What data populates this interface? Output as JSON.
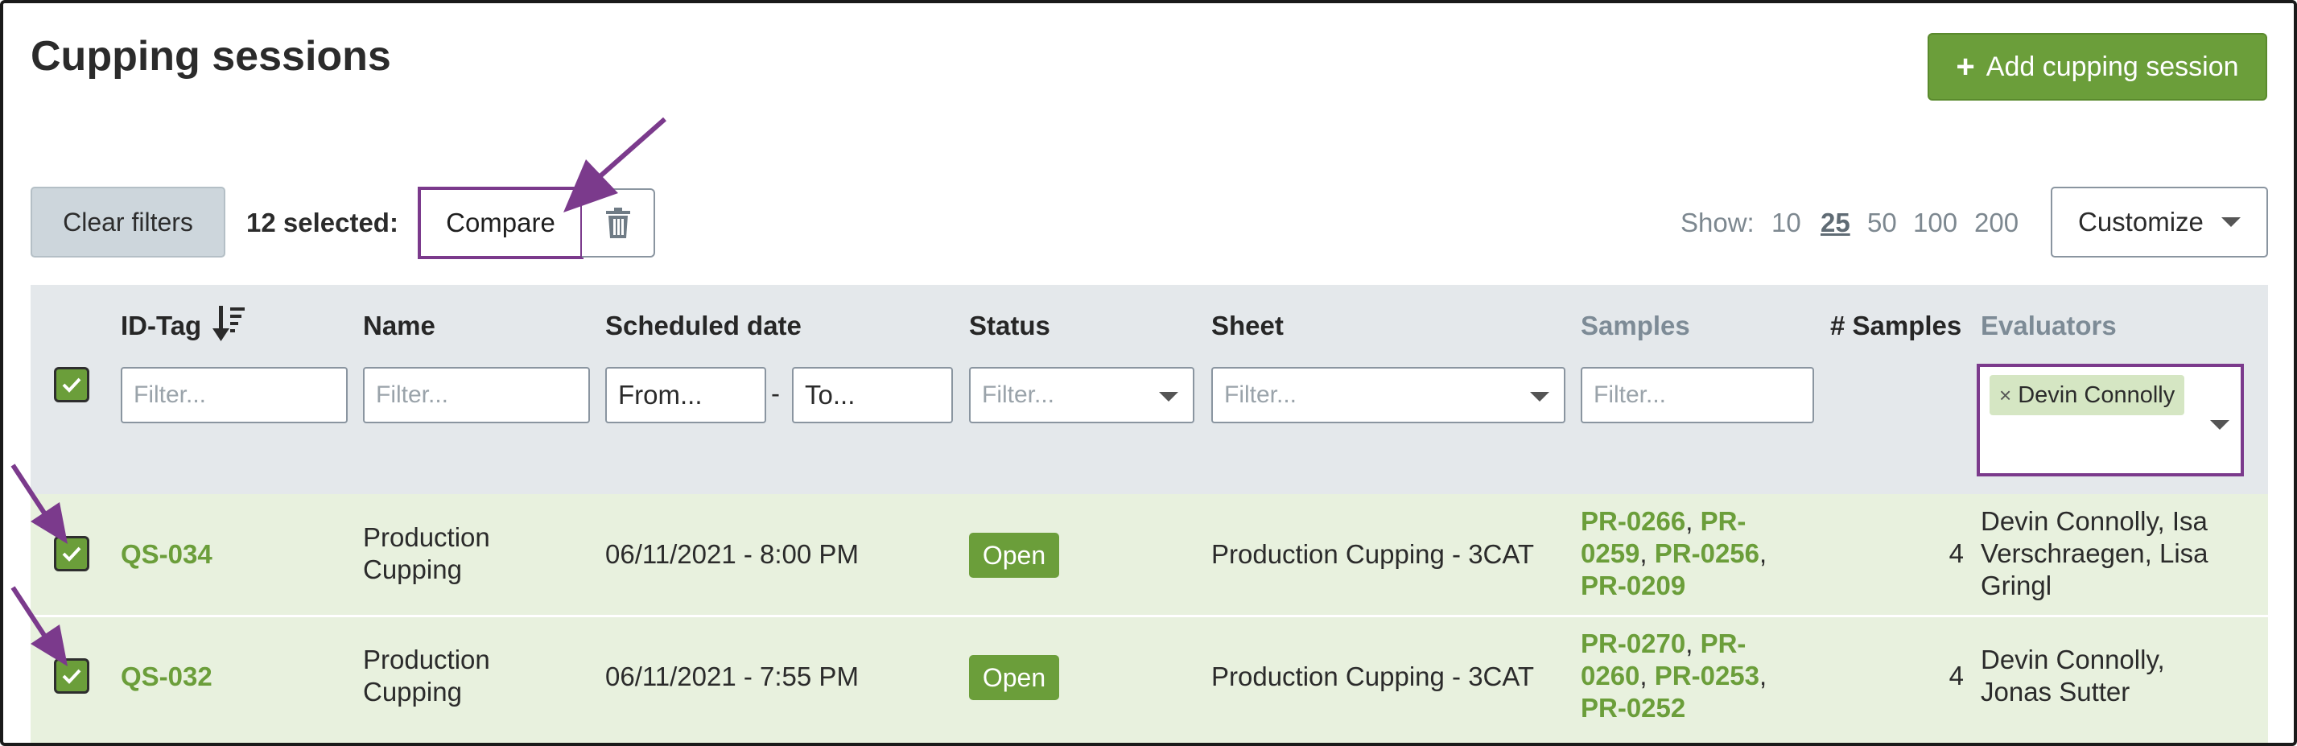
{
  "page": {
    "title": "Cupping sessions"
  },
  "header": {
    "add_button": "Add cupping session",
    "add_icon": "+"
  },
  "toolbar": {
    "clear_filters": "Clear filters",
    "selected_count": "12 selected:",
    "compare": "Compare",
    "delete_icon": "trash-icon"
  },
  "pagination": {
    "show_label": "Show:",
    "sizes": [
      "10",
      "25",
      "50",
      "100",
      "200"
    ],
    "active": "25"
  },
  "customize": {
    "label": "Customize"
  },
  "table": {
    "columns": {
      "id_tag": "ID-Tag",
      "name": "Name",
      "scheduled_date": "Scheduled date",
      "status": "Status",
      "sheet": "Sheet",
      "samples": "Samples",
      "num_samples": "# Samples",
      "evaluators": "Evaluators"
    },
    "filters": {
      "id_tag": "Filter...",
      "name": "Filter...",
      "date_from": "From...",
      "date_to": "To...",
      "status": "Filter...",
      "sheet": "Filter...",
      "samples": "Filter...",
      "evaluator_tag": "Devin Connolly",
      "evaluator_tag_remove": "×"
    },
    "rows": [
      {
        "id": "QS-034",
        "name_line1": "Production",
        "name_line2": "Cupping",
        "date": "06/11/2021 - 8:00 PM",
        "status": "Open",
        "sheet": "Production Cupping - 3CAT",
        "samples": [
          "PR-0266",
          "PR-0259",
          "PR-0256",
          "PR-0209"
        ],
        "num_samples": "4",
        "evaluators_line1": "Devin Connolly, Isa",
        "evaluators_line2": "Verschraegen, Lisa",
        "evaluators_line3": "Gringl"
      },
      {
        "id": "QS-032",
        "name_line1": "Production",
        "name_line2": "Cupping",
        "date": "06/11/2021 - 7:55 PM",
        "status": "Open",
        "sheet": "Production Cupping - 3CAT",
        "samples": [
          "PR-0270",
          "PR-0260",
          "PR-0253",
          "PR-0252"
        ],
        "num_samples": "4",
        "evaluators_line1": "Devin Connolly,",
        "evaluators_line2": "Jonas Sutter",
        "evaluators_line3": ""
      }
    ]
  },
  "colors": {
    "accent_green": "#6b9e3a",
    "annotation_purple": "#7b3a8c",
    "row_bg": "#e8f1de",
    "header_bg": "#e4e8eb"
  }
}
